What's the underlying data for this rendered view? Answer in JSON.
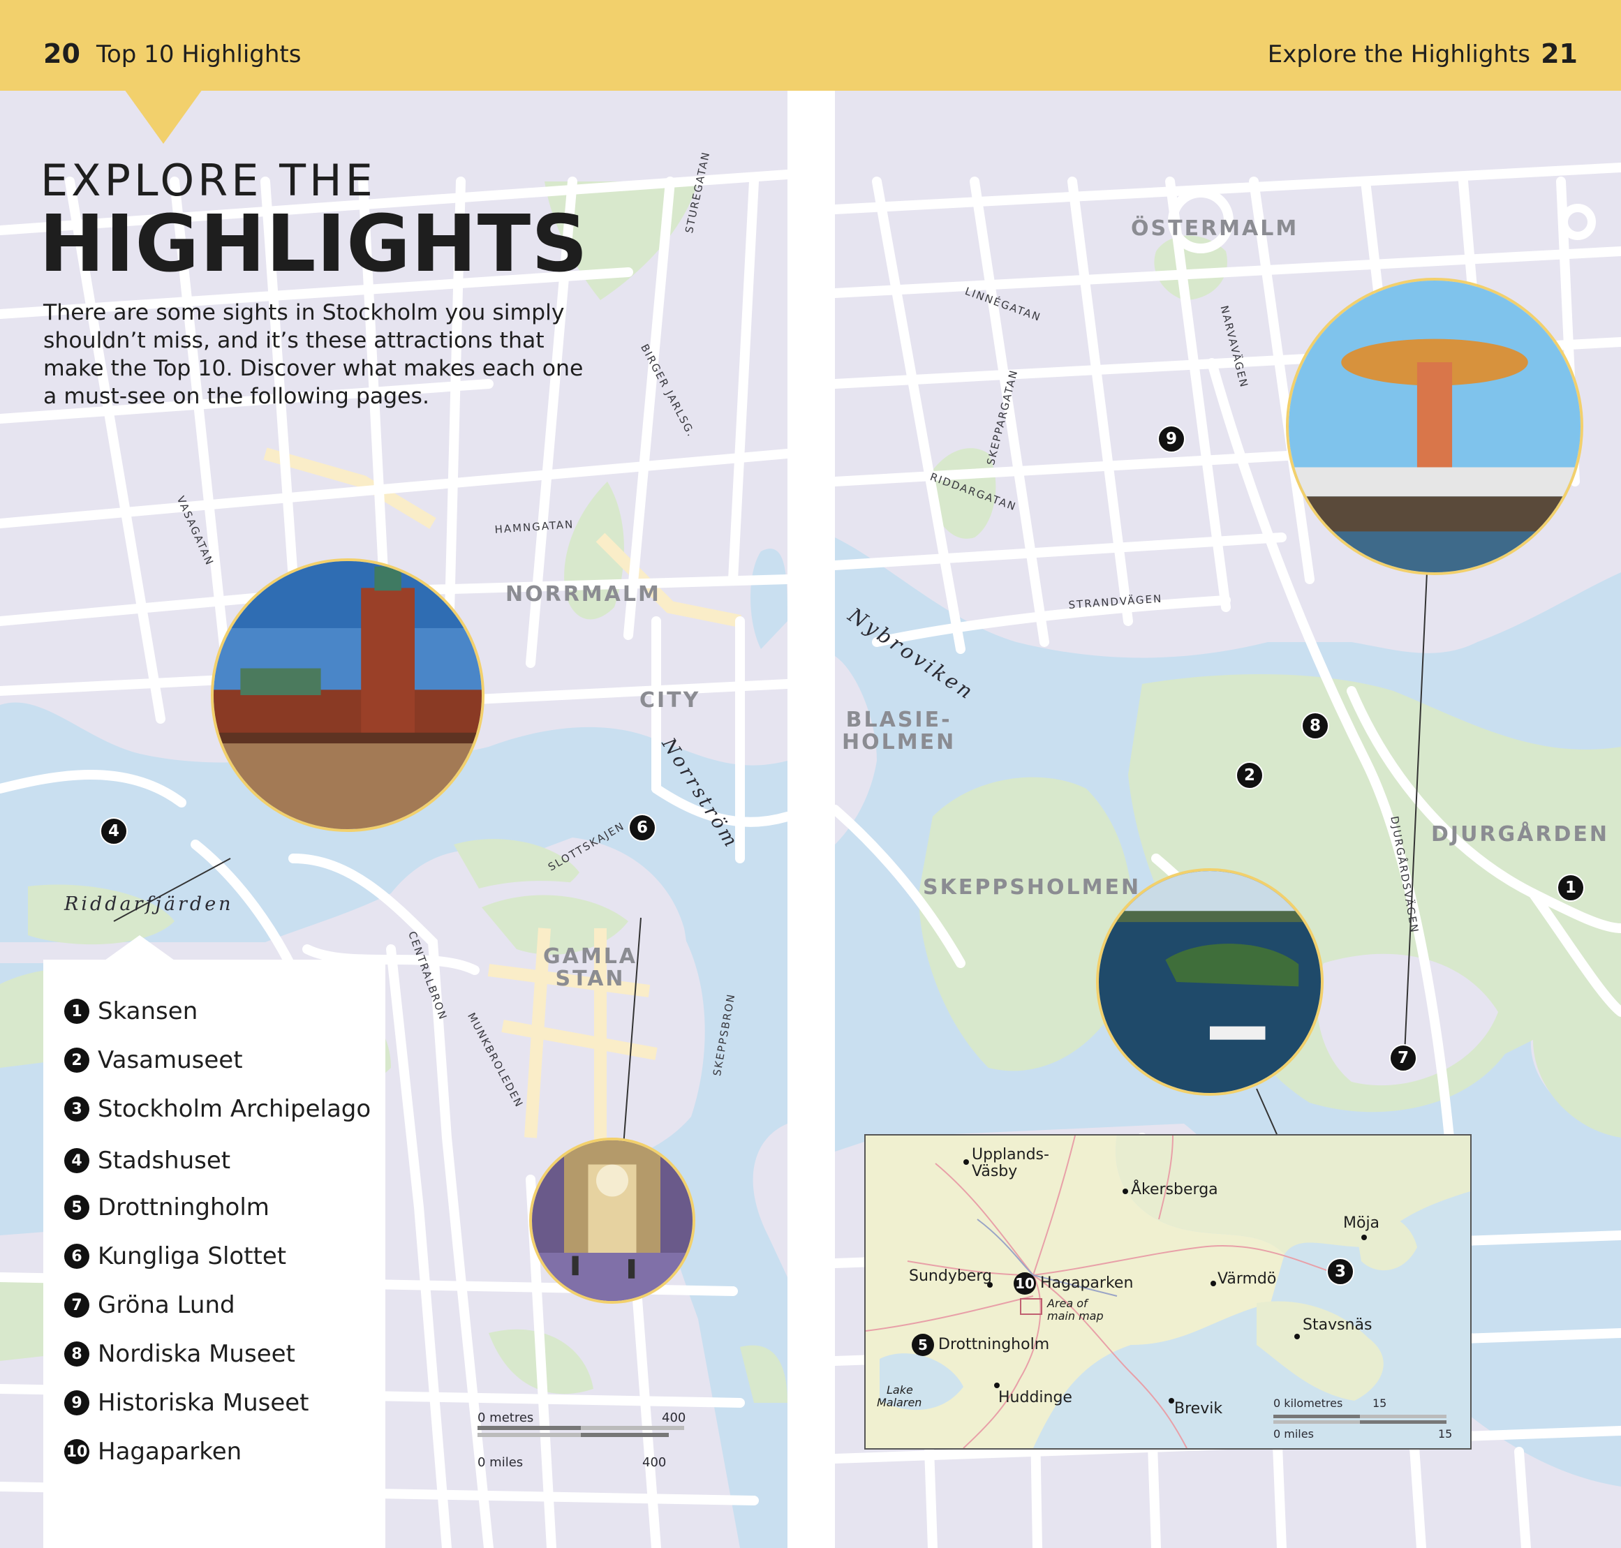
{
  "header": {
    "left_page_number": "20",
    "left_title": "Top 10 Highlights",
    "right_title": "Explore the Highlights",
    "right_page_number": "21",
    "background_color": "#f2d06c"
  },
  "title": {
    "line1": "EXPLORE THE",
    "line2": "HIGHLIGHTS"
  },
  "intro": "There are some sights in Stockholm you simply shouldn’t miss, and it’s these attractions that make the Top 10. Discover what makes each one a must-see on the following pages.",
  "areas": {
    "norrmalm": "NORRMALM",
    "city": "CITY",
    "gamla_stan": [
      "GAMLA",
      "STAN"
    ],
    "ostermalm": "ÖSTERMALM",
    "blasieholmen": [
      "BLASIE-",
      "HOLMEN"
    ],
    "skeppsholmen": "SKEPPSHOLMEN",
    "djurgarden": "DJURGÅRDEN"
  },
  "streets": {
    "sturegatan": "STUREGATAN",
    "birger_jarlsg": "BIRGER JARLSG.",
    "hamngatan": "HAMNGATAN",
    "vasagatan": "VASAGATAN",
    "slottskajen": "SLOTTSKAJEN",
    "centralbron": "CENTRALBRON",
    "munkbroleden": "MUNKBROLEDEN",
    "skeppsbron": "SKEPPSBRON",
    "linnegatan": "LINNÉGATAN",
    "narvavagen": "NARVAVÄGEN",
    "skeppargatan": "SKEPPARGATAN",
    "riddargatan": "RIDDARGATAN",
    "strandvagen": "STRANDVÄGEN",
    "djurgardsvagen": "DJURGÅRDSVÄGEN"
  },
  "water": {
    "riddarfjarden": "Riddarfjärden",
    "norrstrom": "Norrström",
    "nybroviken": "Nybroviken"
  },
  "legend": [
    {
      "num": "1",
      "label": "Skansen"
    },
    {
      "num": "2",
      "label": "Vasamuseet"
    },
    {
      "num": "3",
      "label": "Stockholm Archipelago"
    },
    {
      "num": "4",
      "label": "Stadshuset"
    },
    {
      "num": "5",
      "label": "Drottningholm"
    },
    {
      "num": "6",
      "label": "Kungliga Slottet"
    },
    {
      "num": "7",
      "label": "Gröna Lund"
    },
    {
      "num": "8",
      "label": "Nordiska Museet"
    },
    {
      "num": "9",
      "label": "Historiska Museet"
    },
    {
      "num": "10",
      "label": "Hagaparken"
    }
  ],
  "map_markers": [
    "4",
    "6",
    "9",
    "8",
    "2",
    "1",
    "7",
    "3"
  ],
  "scale_main": {
    "metres_label": "0 metres",
    "metres_value": "400",
    "miles_label": "0 miles",
    "miles_value": "400"
  },
  "inset": {
    "places": {
      "upplands_vasby": [
        "Upplands-",
        "Väsby"
      ],
      "akersberga": "Åkersberga",
      "moja": "Möja",
      "sundyberg": "Sundyberg",
      "varmdo": "Värmdö",
      "stavsnas": "Stavsnäs",
      "huddinge": "Huddinge",
      "brevik": "Brevik",
      "lake_malaren": [
        "Lake",
        "Malaren"
      ]
    },
    "hagaparken_num": "10",
    "hagaparken": "Hagaparken",
    "drottningholm_num": "5",
    "drottningholm": "Drottningholm",
    "area_note": [
      "Area of",
      "main map"
    ],
    "scale": {
      "km_label": "0 kilometres",
      "km_value": "15",
      "miles_label": "0 miles",
      "miles_value": "15"
    }
  },
  "colors": {
    "land": "#e6e4f0",
    "water": "#c9dff0",
    "park": "#d8e8cc",
    "road": "#ffffff",
    "highlight_road": "#faedc8",
    "marker": "#111111"
  }
}
